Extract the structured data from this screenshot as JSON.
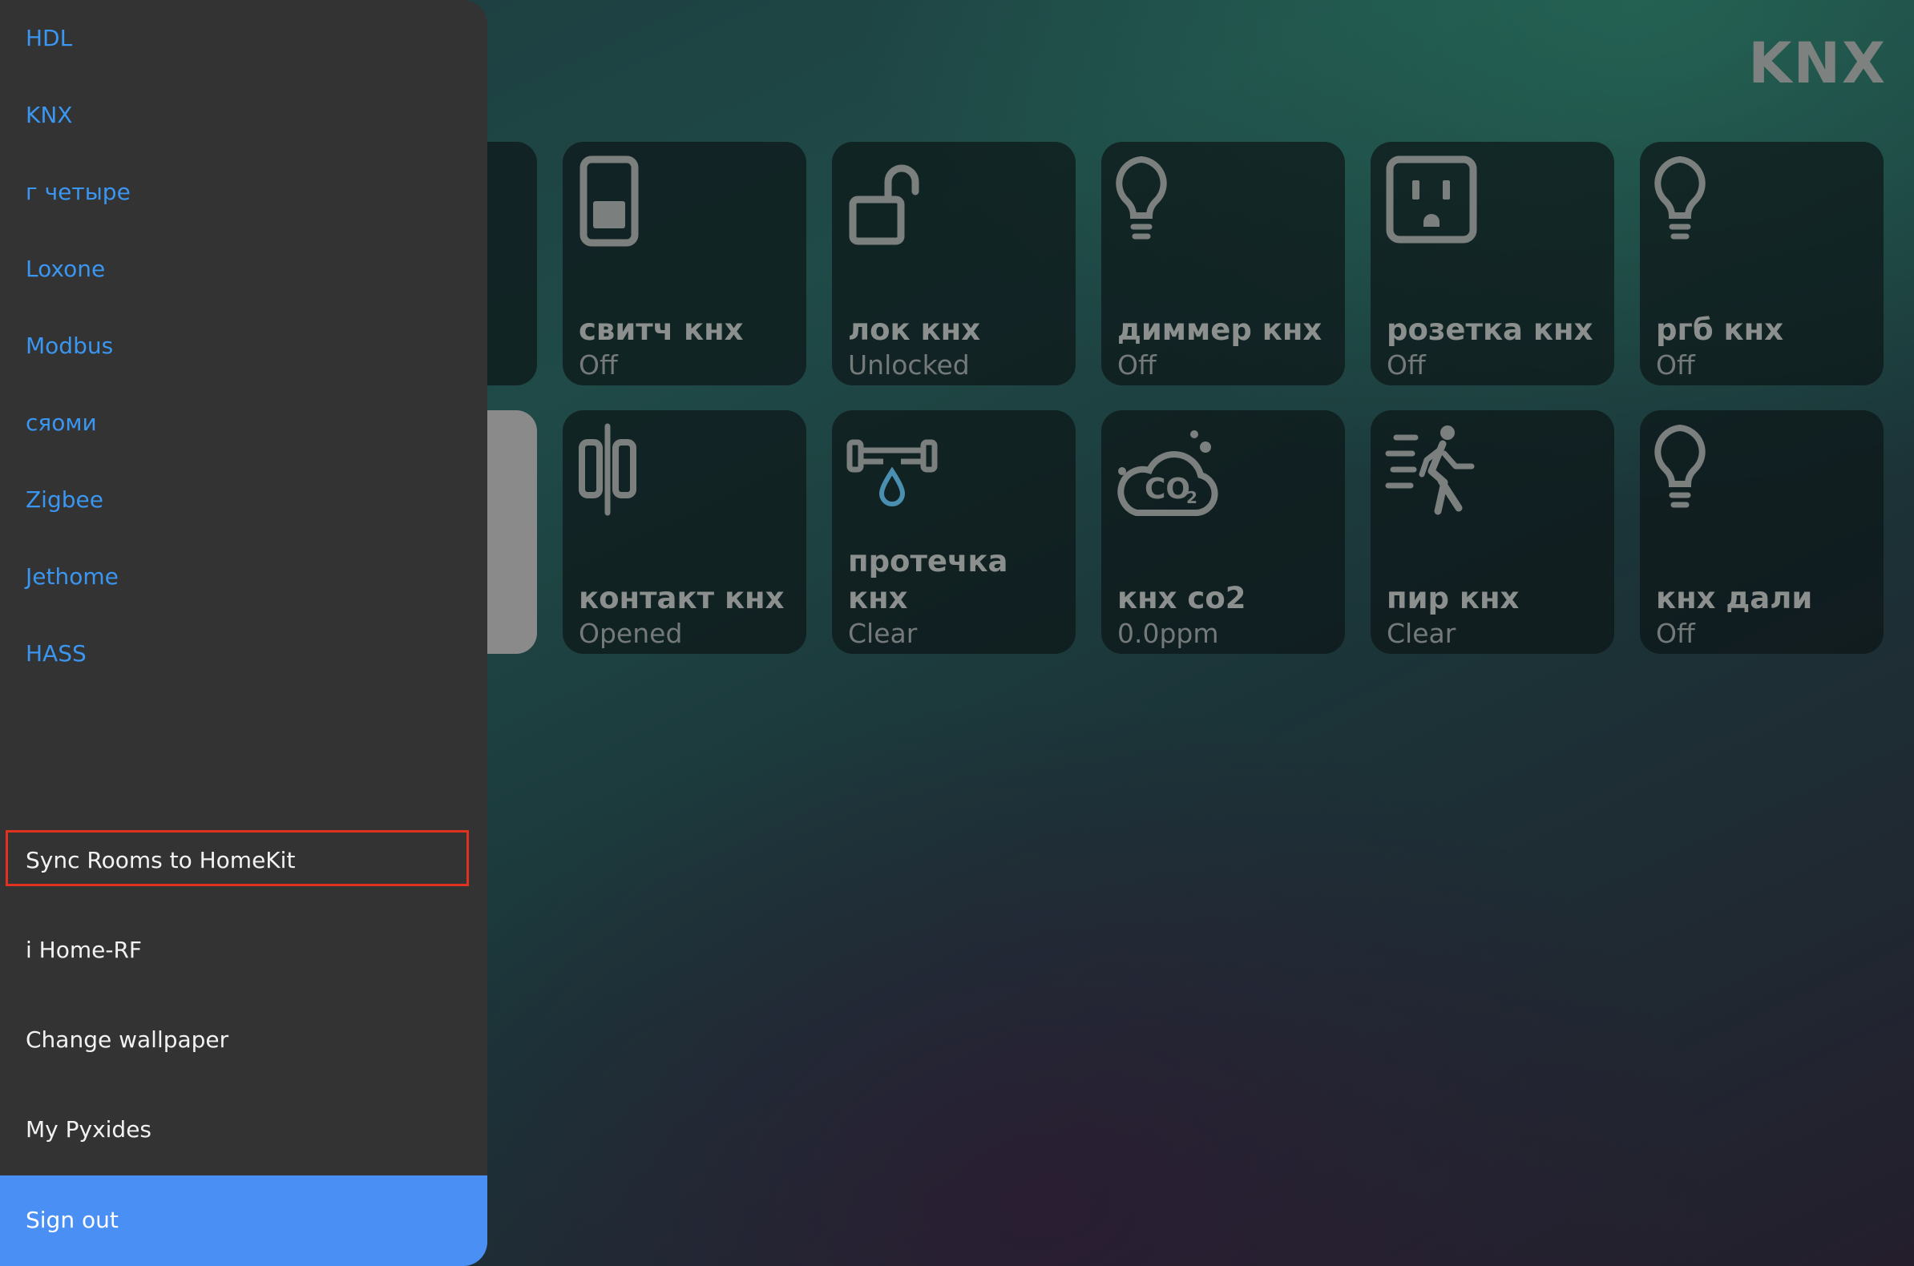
{
  "header": {
    "title": "KNX"
  },
  "sidebar": {
    "nav_items": [
      {
        "label": "HDL"
      },
      {
        "label": "KNX"
      },
      {
        "label": "г четыре"
      },
      {
        "label": "Loxone"
      },
      {
        "label": "Modbus"
      },
      {
        "label": "сяоми"
      },
      {
        "label": "Zigbee"
      },
      {
        "label": "Jethome"
      },
      {
        "label": "HASS"
      }
    ],
    "actions": [
      {
        "label": "Sync Rooms to HomeKit"
      },
      {
        "label": "i Home-RF"
      },
      {
        "label": "Change wallpaper"
      },
      {
        "label": "My Pyxides"
      }
    ],
    "sign_out": "Sign out"
  },
  "devices": [
    {
      "name": "свитч кнх",
      "state": "Off",
      "icon": "switch-icon"
    },
    {
      "name": "лок кнх",
      "state": "Unlocked",
      "icon": "lock-open-icon"
    },
    {
      "name": "диммер кнх",
      "state": "Off",
      "icon": "lightbulb-icon"
    },
    {
      "name": "розетка кнх",
      "state": "Off",
      "icon": "outlet-icon"
    },
    {
      "name": "ргб кнх",
      "state": "Off",
      "icon": "lightbulb-icon"
    },
    {
      "name": "контакт кнх",
      "state": "Opened",
      "icon": "contact-sensor-icon"
    },
    {
      "name": "протечка кнх",
      "state": "Clear",
      "icon": "leak-sensor-icon"
    },
    {
      "name": "кнх co2",
      "state": "0.0ppm",
      "icon": "co2-cloud-icon"
    },
    {
      "name": "пир кнх",
      "state": "Clear",
      "icon": "motion-sensor-icon"
    },
    {
      "name": "кнх дали",
      "state": "Off",
      "icon": "lightbulb-icon"
    }
  ],
  "colors": {
    "accent": "#3a96f0",
    "sign_out_bg": "#4a8ff3",
    "highlight_border": "#e0321e",
    "sidebar_bg": "#333333",
    "leak_drop": "#4a8fb0"
  }
}
